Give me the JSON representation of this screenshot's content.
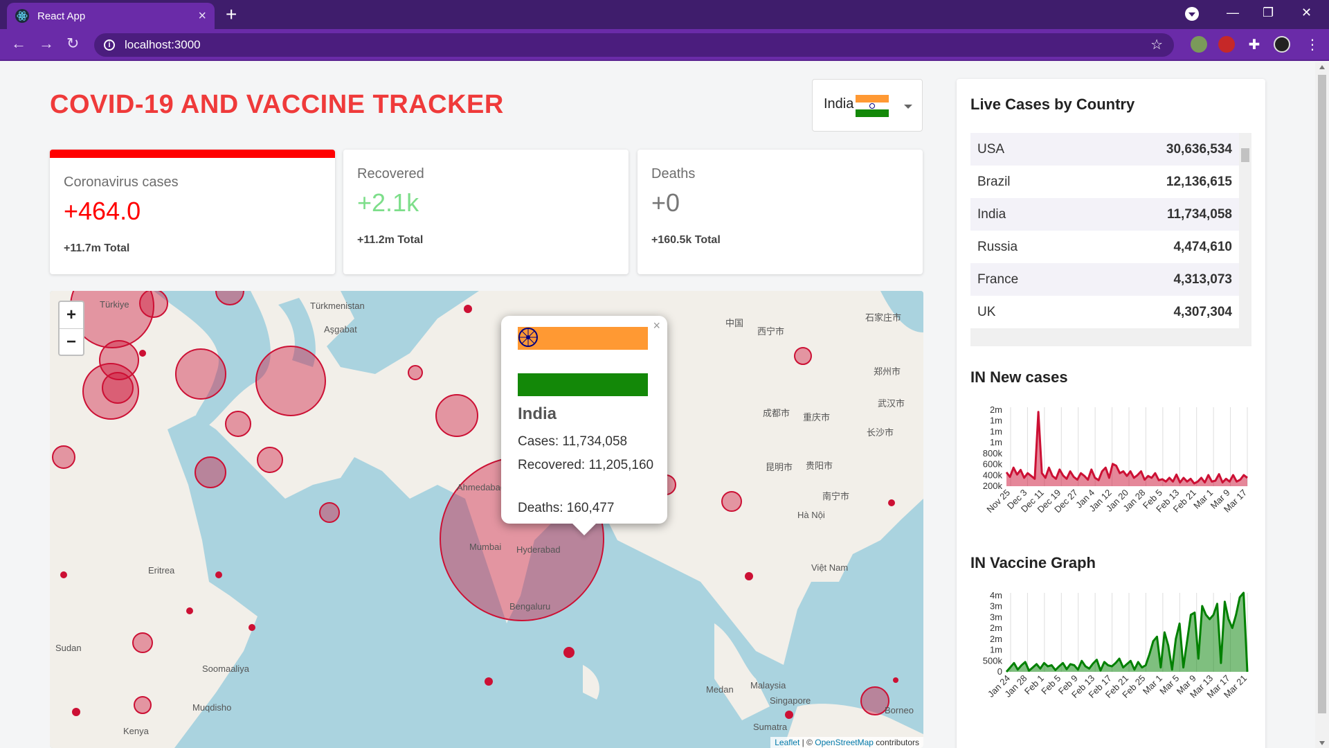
{
  "browser": {
    "tab_title": "React App",
    "url": "localhost:3000"
  },
  "page": {
    "title": "COVID-19 AND VACCINE TRACKER",
    "country_select": {
      "selected": "India"
    }
  },
  "cards": [
    {
      "title": "Coronavirus cases",
      "value": "+464.0",
      "total": "+11.7m Total",
      "color": "#ff0000"
    },
    {
      "title": "Recovered",
      "value": "+2.1k",
      "total": "+11.2m Total",
      "color": "#7dde8a"
    },
    {
      "title": "Deaths",
      "value": "+0",
      "total": "+160.5k Total",
      "color": "#777777"
    }
  ],
  "map": {
    "zoom_in": "+",
    "zoom_out": "−",
    "attribution_leaflet": "Leaflet",
    "attribution_sep": " | © ",
    "attribution_osm": "OpenStreetMap",
    "attribution_tail": " contributors",
    "labels": [
      "Türkiye",
      "Türkmenistan",
      "Aşgabat",
      "中国",
      "西宁市",
      "Mumbai",
      "Hyderabad",
      "Bengaluru",
      "Ahmedabad",
      "Eritrea",
      "Sudan",
      "Soomaaliya",
      "Muqdisho",
      "Kenya",
      "Medan",
      "Malaysia",
      "Singapore",
      "Sumatra",
      "Borneo",
      "Việt Nam",
      "Hà Nội",
      "重庆市",
      "成都市",
      "南宁市",
      "昆明市",
      "贵阳市",
      "武汉市",
      "长沙市",
      "郑州市",
      "石家庄市"
    ],
    "popup": {
      "close": "×",
      "country": "India",
      "cases": "Cases: 11,734,058",
      "recovered": "Recovered: 11,205,160",
      "deaths": "Deaths: 160,477"
    }
  },
  "live_cases": {
    "title": "Live Cases by Country",
    "rows": [
      {
        "country": "USA",
        "cases": "30,636,534"
      },
      {
        "country": "Brazil",
        "cases": "12,136,615"
      },
      {
        "country": "India",
        "cases": "11,734,058"
      },
      {
        "country": "Russia",
        "cases": "4,474,610"
      },
      {
        "country": "France",
        "cases": "4,313,073"
      },
      {
        "country": "UK",
        "cases": "4,307,304"
      }
    ]
  },
  "chart_data": [
    {
      "type": "area",
      "title": "IN New cases",
      "color": "#cc1034",
      "fill": "rgba(204,16,52,0.5)",
      "ytick_labels": [
        "2m",
        "1m",
        "1m",
        "1m",
        "800k",
        "600k",
        "400k",
        "200k"
      ],
      "ylim": [
        200000,
        1900000
      ],
      "xtick_labels": [
        "Nov 25",
        "Dec 3",
        "Dec 11",
        "Dec 19",
        "Dec 27",
        "Jan 4",
        "Jan 12",
        "Jan 20",
        "Jan 28",
        "Feb 5",
        "Feb 13",
        "Feb 21",
        "Mar 1",
        "Mar 9",
        "Mar 17"
      ],
      "values": [
        500000,
        400000,
        600000,
        450000,
        550000,
        380000,
        480000,
        420000,
        360000,
        1800000,
        480000,
        380000,
        600000,
        420000,
        360000,
        560000,
        430000,
        360000,
        520000,
        400000,
        340000,
        480000,
        420000,
        340000,
        560000,
        380000,
        330000,
        520000,
        600000,
        380000,
        680000,
        640000,
        480000,
        520000,
        420000,
        520000,
        380000,
        440000,
        520000,
        340000,
        420000,
        380000,
        480000,
        330000,
        350000,
        300000,
        380000,
        300000,
        450000,
        280000,
        380000,
        300000,
        360000,
        260000,
        300000,
        380000,
        280000,
        440000,
        300000,
        320000,
        460000,
        280000,
        360000,
        300000,
        440000,
        300000,
        340000,
        440000,
        380000
      ]
    },
    {
      "type": "area",
      "title": "IN Vaccine Graph",
      "color": "#008000",
      "fill": "rgba(0,128,0,0.5)",
      "ytick_labels": [
        "4m",
        "3m",
        "3m",
        "2m",
        "2m",
        "1m",
        "500k",
        "0"
      ],
      "ylim": [
        0,
        3600000
      ],
      "xtick_labels": [
        "Jan 24",
        "Jan 28",
        "Feb 1",
        "Feb 5",
        "Feb 9",
        "Feb 13",
        "Feb 17",
        "Feb 21",
        "Feb 25",
        "Mar 1",
        "Mar 5",
        "Mar 9",
        "Mar 13",
        "Mar 17",
        "Mar 21"
      ],
      "values": [
        0,
        200000,
        400000,
        100000,
        300000,
        450000,
        50000,
        200000,
        350000,
        150000,
        400000,
        250000,
        300000,
        80000,
        250000,
        400000,
        120000,
        350000,
        300000,
        100000,
        500000,
        250000,
        150000,
        380000,
        550000,
        60000,
        450000,
        300000,
        250000,
        400000,
        600000,
        200000,
        350000,
        500000,
        100000,
        450000,
        200000,
        300000,
        800000,
        1400000,
        1600000,
        200000,
        1800000,
        1200000,
        100000,
        1500000,
        2200000,
        200000,
        1400000,
        2600000,
        2700000,
        600000,
        3000000,
        2600000,
        2400000,
        2600000,
        3100000,
        400000,
        3200000,
        2400000,
        2000000,
        2600000,
        3400000,
        3600000,
        0
      ]
    }
  ]
}
